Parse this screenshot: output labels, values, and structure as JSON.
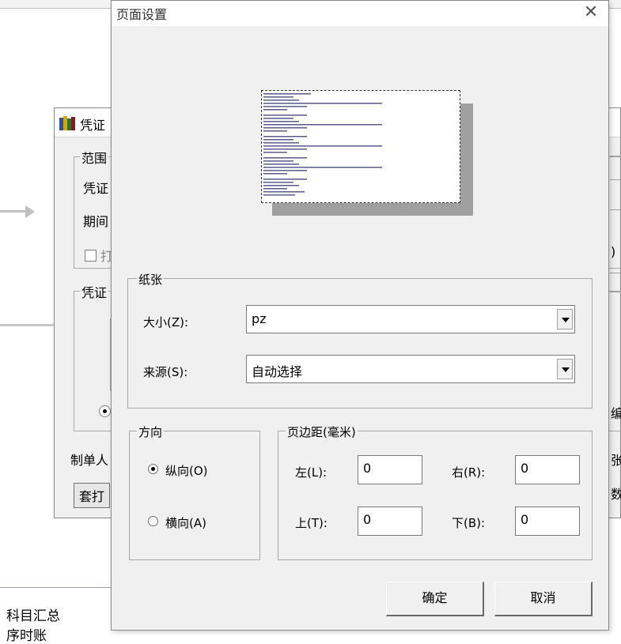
{
  "background": {
    "bottom_items": [
      "科目汇总",
      "序时账"
    ]
  },
  "voucher_window": {
    "title": "凭证",
    "range_group": "范围",
    "voucher_label": "凭证",
    "period_label": "期间",
    "checkbox_label": "打",
    "voucher_group": "凭证",
    "maker_label": "制单人",
    "print_button": "套打",
    "right_text_1": ")",
    "right_text_2": "编",
    "right_text_3": "张",
    "right_text_4": "数"
  },
  "dialog": {
    "title": "页面设置",
    "close_icon": "close-icon",
    "paper": {
      "group_label": "纸张",
      "size_label": "大小(Z):",
      "size_value": "pz",
      "source_label": "来源(S):",
      "source_value": "自动选择"
    },
    "orientation": {
      "group_label": "方向",
      "portrait_label": "纵向(O)",
      "landscape_label": "横向(A)",
      "selected": "portrait"
    },
    "margins": {
      "group_label": "页边距(毫米)",
      "left_label": "左(L):",
      "left_value": "0",
      "right_label": "右(R):",
      "right_value": "0",
      "top_label": "上(T):",
      "top_value": "0",
      "bottom_label": "下(B):",
      "bottom_value": "0"
    },
    "ok_button": "确定",
    "cancel_button": "取消"
  }
}
